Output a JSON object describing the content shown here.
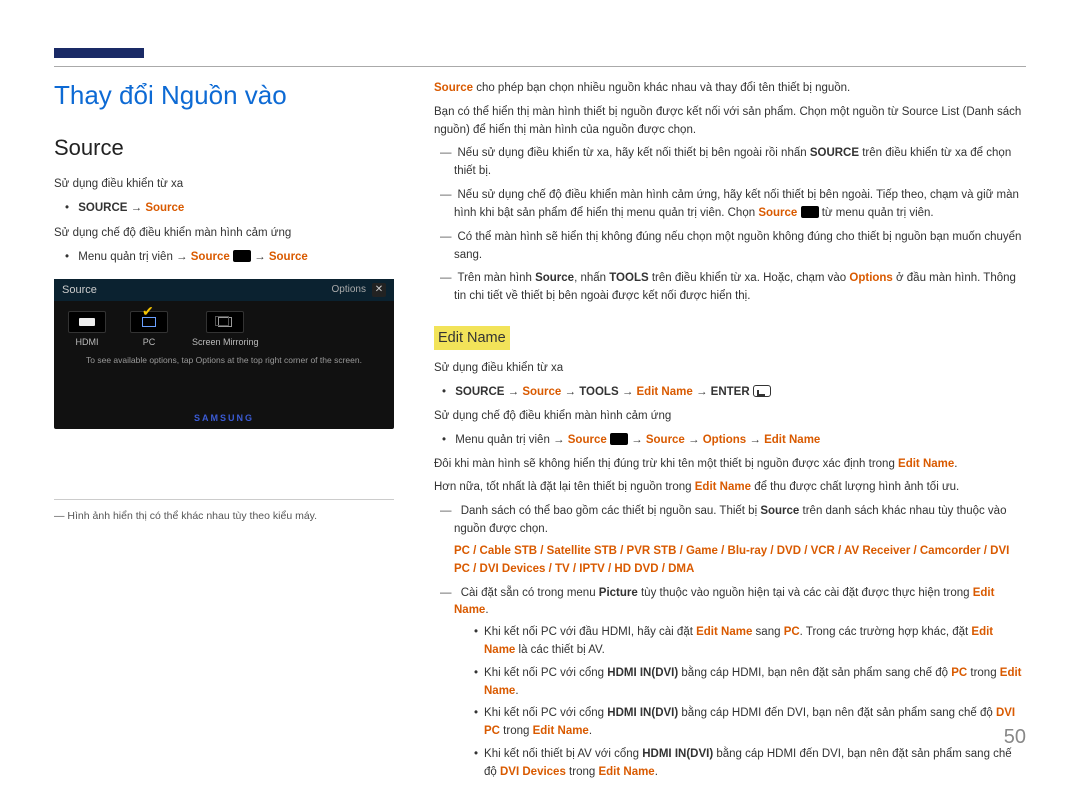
{
  "page_number": "50",
  "title": "Thay đổi Nguồn vào",
  "section": "Source",
  "left": {
    "remote_line": "Sử dụng điều khiển từ xa",
    "bullet1_b1": "SOURCE",
    "bullet1_arrow": " → ",
    "bullet1_o1": "Source",
    "touch_line": "Sử dụng chế độ điều khiển màn hình cảm ứng",
    "bullet2_pre": "Menu quản trị viên → ",
    "bullet2_o1": "Source",
    "bullet2_mid": " → ",
    "bullet2_o2": "Source",
    "footnote": "― Hình ảnh hiển thị có thể khác nhau tùy theo kiểu máy.",
    "ss": {
      "title": "Source",
      "options": "Options",
      "hdmi": "HDMI",
      "pc": "PC",
      "mirror": "Screen Mirroring",
      "hint": "To see available options, tap Options at the top right corner of the screen.",
      "logo": "SAMSUNG"
    }
  },
  "right": {
    "p1_a": "Source",
    "p1_b": " cho phép bạn chọn nhiều nguồn khác nhau và thay đổi tên thiết bị nguồn.",
    "p2": "Bạn có thể hiển thị màn hình thiết bị nguồn được kết nối với sản phẩm. Chọn một nguồn từ Source List (Danh sách nguồn) để hiển thị màn hình của nguồn được chọn.",
    "d1_a": "Nếu sử dụng điều khiển từ xa, hãy kết nối thiết bị bên ngoài rồi nhấn ",
    "d1_b": "SOURCE",
    "d1_c": " trên điều khiển từ xa để chọn thiết bị.",
    "d2_a": "Nếu sử dụng chế độ điều khiển màn hình cảm ứng, hãy kết nối thiết bị bên ngoài. Tiếp theo, chạm và giữ màn hình khi bật sản phẩm để hiển thị menu quản trị viên. Chọn ",
    "d2_b": "Source",
    "d2_c": " từ menu quản trị viên.",
    "d3": "Có thể màn hình sẽ hiển thị không đúng nếu chọn một nguồn không đúng cho thiết bị nguồn bạn muốn chuyển sang.",
    "d4_a": "Trên màn hình ",
    "d4_b": "Source",
    "d4_c": ", nhấn ",
    "d4_d": "TOOLS",
    "d4_e": " trên điều khiển từ xa. Hoặc, chạm vào ",
    "d4_f": "Options",
    "d4_g": " ở đầu màn hình. Thông tin chi tiết về thiết bị bên ngoài được kết nối được hiển thị.",
    "edit_name": "Edit Name",
    "remote_line": "Sử dụng điều khiển từ xa",
    "eb1_a": "SOURCE",
    "eb1_b": " → ",
    "eb1_c": "Source",
    "eb1_d": " → ",
    "eb1_e": "TOOLS",
    "eb1_f": " → ",
    "eb1_g": "Edit Name",
    "eb1_h": " → ",
    "eb1_i": "ENTER",
    "touch_line": "Sử dụng chế độ điều khiển màn hình cảm ứng",
    "eb2_a": "Menu quản trị viên → ",
    "eb2_b": "Source",
    "eb2_c": " → ",
    "eb2_d": "Source",
    "eb2_e": " → ",
    "eb2_f": "Options",
    "eb2_g": " → ",
    "eb2_h": "Edit Name",
    "p3_a": "Đôi khi màn hình sẽ không hiển thị đúng trừ khi tên một thiết bị nguồn được xác định trong ",
    "p3_b": "Edit Name",
    "p3_c": ".",
    "p4_a": "Hơn nữa, tốt nhất là đặt lại tên thiết bị nguồn trong ",
    "p4_b": "Edit Name",
    "p4_c": " để thu được chất lượng hình ảnh tối ưu.",
    "d5_a": "Danh sách có thể bao gồm các thiết bị nguồn sau. Thiết bị ",
    "d5_b": "Source",
    "d5_c": " trên danh sách khác nhau tùy thuộc vào nguồn được chọn.",
    "d5_list": "PC / Cable STB / Satellite STB / PVR STB / Game / Blu-ray / DVD / VCR / AV Receiver / Camcorder / DVI PC / DVI Devices / TV / IPTV / HD DVD / DMA",
    "d6_a": "Cài đặt sẵn có trong menu ",
    "d6_b": "Picture",
    "d6_c": " tùy thuộc vào nguồn hiện tại và các cài đặt được thực hiện trong ",
    "d6_d": "Edit Name",
    "d6_e": ".",
    "sb1_a": "Khi kết nối PC với đầu HDMI, hãy cài đặt ",
    "sb1_b": "Edit Name",
    "sb1_c": " sang ",
    "sb1_d": "PC",
    "sb1_e": ". Trong các trường hợp khác, đặt ",
    "sb1_f": "Edit Name",
    "sb1_g": " là các thiết bị AV.",
    "sb2_a": "Khi kết nối PC với cổng ",
    "sb2_b": "HDMI IN(DVI)",
    "sb2_c": " bằng cáp HDMI, bạn nên đặt sản phẩm sang chế độ ",
    "sb2_d": "PC",
    "sb2_e": " trong ",
    "sb2_f": "Edit Name",
    "sb2_g": ".",
    "sb3_a": "Khi kết nối PC với cổng ",
    "sb3_b": "HDMI IN(DVI)",
    "sb3_c": " bằng cáp HDMI đến DVI, bạn nên đặt sản phẩm sang chế độ ",
    "sb3_d": "DVI PC",
    "sb3_e": " trong ",
    "sb3_f": "Edit Name",
    "sb3_g": ".",
    "sb4_a": "Khi kết nối thiết bị AV với cổng ",
    "sb4_b": "HDMI IN(DVI)",
    "sb4_c": " bằng cáp HDMI đến DVI, bạn nên đặt sản phẩm sang chế độ ",
    "sb4_d": "DVI Devices",
    "sb4_e": " trong ",
    "sb4_f": "Edit Name",
    "sb4_g": "."
  }
}
